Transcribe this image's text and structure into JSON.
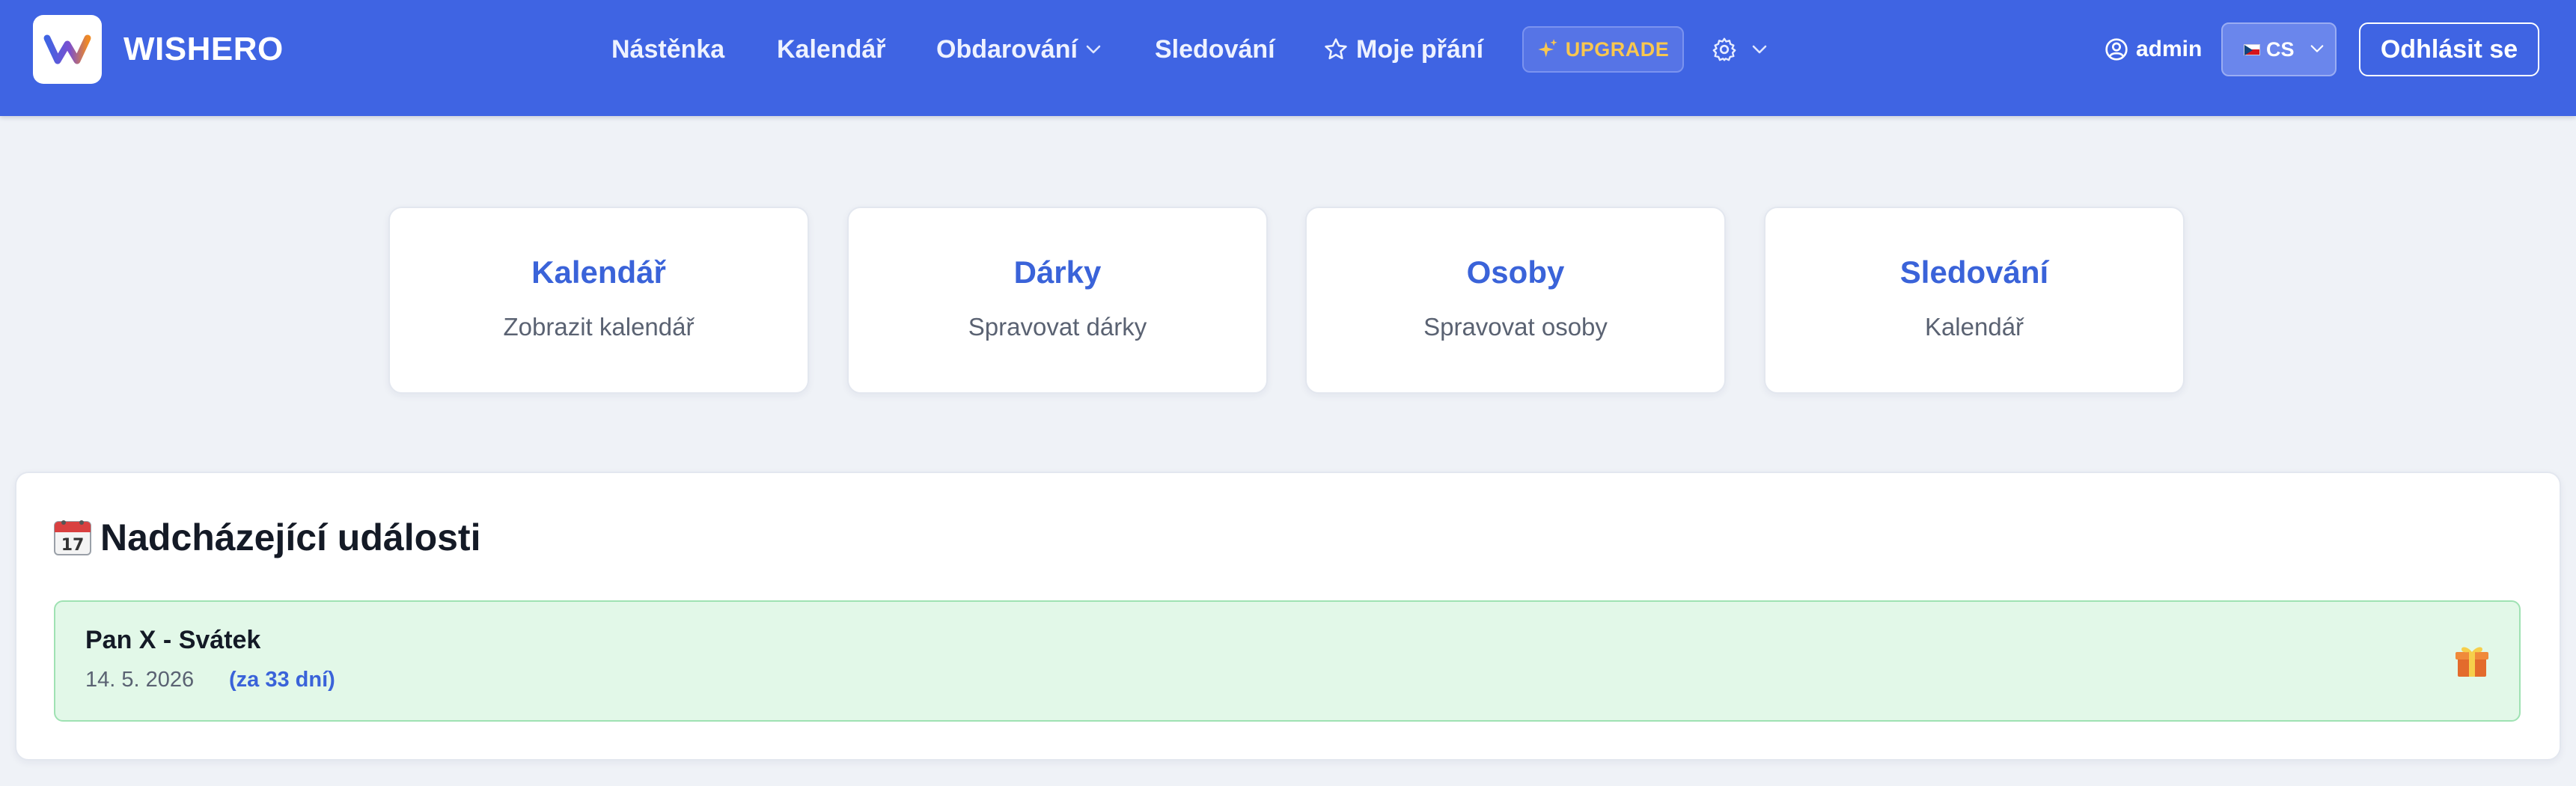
{
  "brand": {
    "name": "WISHERO",
    "colors": {
      "primary": "#3f64e3",
      "accent": "#f9c74f"
    }
  },
  "nav": {
    "items": [
      {
        "label": "Nástěnka"
      },
      {
        "label": "Kalendář"
      },
      {
        "label": "Obdarování",
        "icon": "chevron-down-icon"
      },
      {
        "label": "Sledování"
      },
      {
        "label": "Moje přání",
        "icon": "star-icon"
      }
    ],
    "upgrade_label": "UPGRADE",
    "settings_icon": "gear-icon",
    "user": {
      "name": "admin",
      "icon": "user-circle-icon"
    },
    "language": {
      "selected": "CS",
      "flag": "czech-flag-icon"
    },
    "logout_label": "Odhlásit se"
  },
  "quick_cards": [
    {
      "title": "Kalendář",
      "subtitle": "Zobrazit kalendář"
    },
    {
      "title": "Dárky",
      "subtitle": "Spravovat dárky"
    },
    {
      "title": "Osoby",
      "subtitle": "Spravovat osoby"
    },
    {
      "title": "Sledování",
      "subtitle": "Kalendář"
    }
  ],
  "events": {
    "title": "Nadcházející události",
    "title_icon": "calendar-17-icon",
    "items": [
      {
        "name": "Pan X - Svátek",
        "date": "14. 5. 2026",
        "countdown": "(za 33 dní)",
        "icon": "gift-icon",
        "status_color": "#e2f8e8"
      }
    ]
  }
}
